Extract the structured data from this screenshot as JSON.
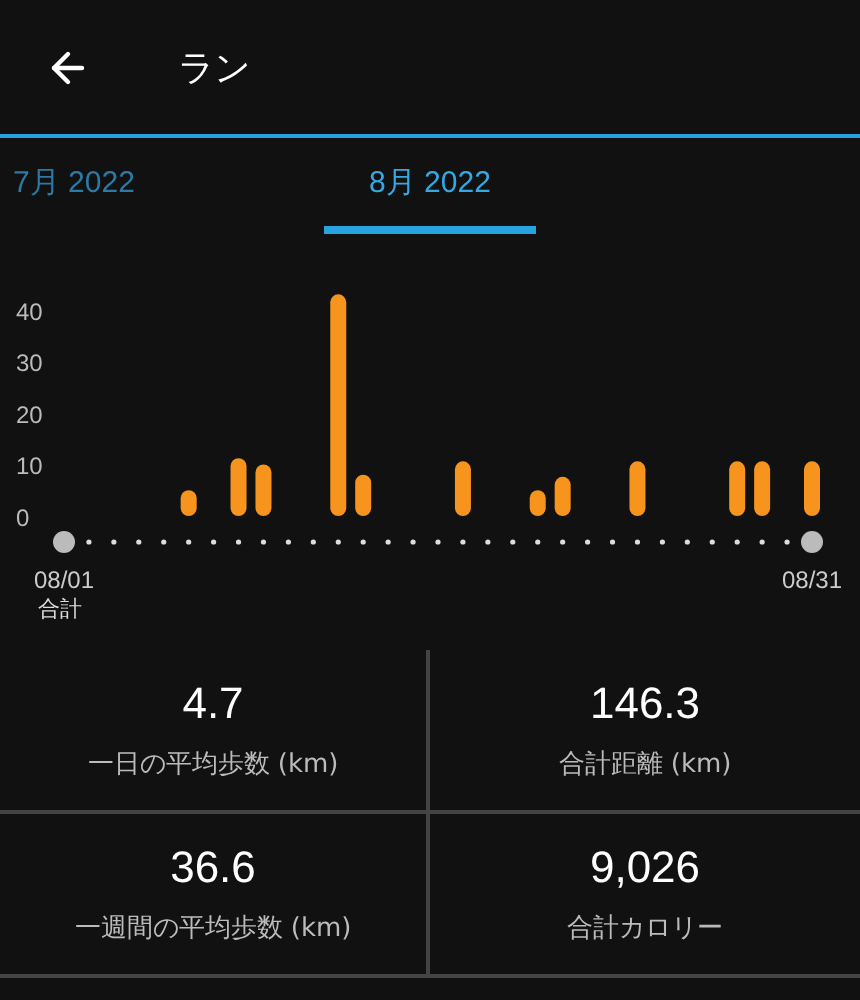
{
  "header": {
    "title": "ラン"
  },
  "tabs": [
    {
      "label": "7月 2022",
      "selected": false
    },
    {
      "label": "8月 2022",
      "selected": true
    }
  ],
  "chart": {
    "chart_data": {
      "type": "bar",
      "categories": [
        "08/01",
        null,
        null,
        null,
        null,
        null,
        null,
        null,
        null,
        null,
        null,
        null,
        null,
        null,
        null,
        null,
        null,
        null,
        null,
        null,
        null,
        null,
        null,
        null,
        null,
        null,
        null,
        null,
        null,
        null,
        "08/31"
      ],
      "values": [
        0,
        0,
        0,
        0,
        0,
        5,
        0,
        11.2,
        10,
        0,
        0,
        43,
        8,
        0,
        0,
        0,
        10.6,
        0,
        0,
        5,
        7.6,
        0,
        0,
        10.6,
        0,
        0,
        0,
        10.6,
        10.6,
        0,
        10.6
      ],
      "yticks": [
        0,
        10,
        20,
        30,
        40
      ],
      "ylim": [
        0,
        45
      ]
    }
  },
  "section_label": "合計",
  "stats": [
    {
      "value": "4.7",
      "label": "一日の平均歩数 (km)"
    },
    {
      "value": "146.3",
      "label": "合計距離 (km)"
    },
    {
      "value": "36.6",
      "label": "一週間の平均歩数 (km)"
    },
    {
      "value": "9,026",
      "label": "合計カロリー"
    }
  ]
}
